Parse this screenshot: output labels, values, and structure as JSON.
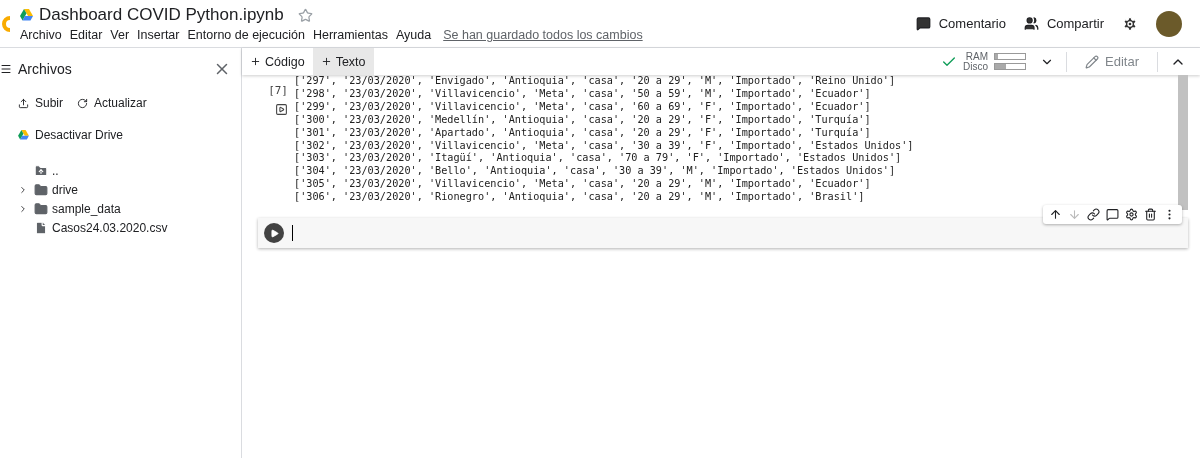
{
  "header": {
    "title": "Dashboard COVID Python.ipynb",
    "starred": false,
    "menu": [
      "Archivo",
      "Editar",
      "Ver",
      "Insertar",
      "Entorno de ejecución",
      "Herramientas",
      "Ayuda"
    ],
    "save_status": "Se han guardado todos los cambios",
    "comment": "Comentario",
    "share": "Compartir"
  },
  "toolbar": {
    "add_buttons": [
      {
        "label": "Código",
        "selected": false
      },
      {
        "label": "Texto",
        "selected": true
      }
    ],
    "connected": true,
    "ram": {
      "label": "RAM",
      "level": 0.1
    },
    "disk": {
      "label": "Disco",
      "level": 0.35
    },
    "edit": "Editar"
  },
  "sidebar": {
    "title": "Archivos",
    "actions": [
      "Subir",
      "Actualizar"
    ],
    "drive": "Desactivar Drive",
    "files": [
      {
        "name": "..",
        "kind": "parent"
      },
      {
        "name": "drive",
        "kind": "folder",
        "expanded": false
      },
      {
        "name": "sample_data",
        "kind": "folder",
        "expanded": false
      },
      {
        "name": "Casos24.03.2020.csv",
        "kind": "file"
      }
    ]
  },
  "cells": [
    {
      "kind": "output",
      "execution_count": "[7]",
      "lines": [
        "['297', '23/03/2020', 'Envigado', 'Antioquia', 'casa', '20 a 29', 'M', 'Importado', 'Reino Unido']",
        "['298', '23/03/2020', 'Villavicencio', 'Meta', 'casa', '50 a 59', 'M', 'Importado', 'Ecuador']",
        "['299', '23/03/2020', 'Villavicencio', 'Meta', 'casa', '60 a 69', 'F', 'Importado', 'Ecuador']",
        "['300', '23/03/2020', 'Medellín', 'Antioquia', 'casa', '20 a 29', 'F', 'Importado', 'Turquía']",
        "['301', '23/03/2020', 'Apartado', 'Antioquia', 'casa', '20 a 29', 'F', 'Importado', 'Turquía']",
        "['302', '23/03/2020', 'Villavicencio', 'Meta', 'casa', '30 a 39', 'F', 'Importado', 'Estados Unidos']",
        "['303', '23/03/2020', 'Itagüí', 'Antioquia', 'casa', '70 a 79', 'F', 'Importado', 'Estados Unidos']",
        "['304', '23/03/2020', 'Bello', 'Antioquia', 'casa', '30 a 39', 'M', 'Importado', 'Estados Unidos']",
        "['305', '23/03/2020', 'Villavicencio', 'Meta', 'casa', '20 a 29', 'M', 'Importado', 'Ecuador']",
        "['306', '23/03/2020', 'Rionegro', 'Antioquia', 'casa', '20 a 29', 'M', 'Importado', 'Brasil']"
      ]
    },
    {
      "kind": "code",
      "selected": true
    }
  ]
}
